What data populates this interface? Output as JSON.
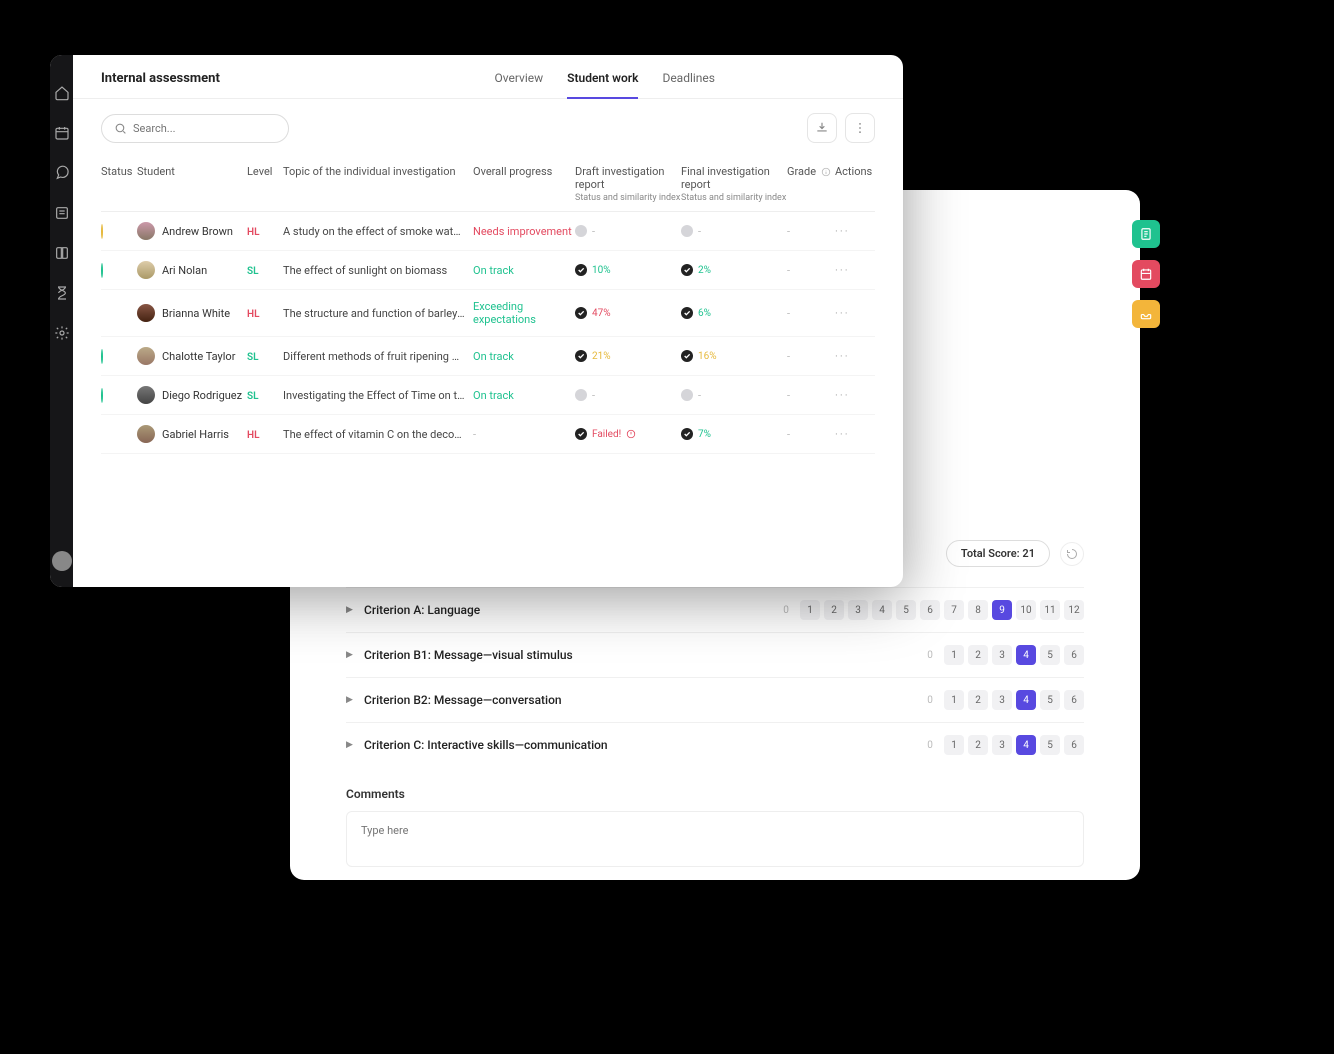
{
  "panel1": {
    "title": "Internal assessment",
    "tabs": [
      {
        "label": "Overview",
        "active": false
      },
      {
        "label": "Student work",
        "active": true
      },
      {
        "label": "Deadlines",
        "active": false
      }
    ],
    "search_placeholder": "Search...",
    "columns": {
      "status": "Status",
      "student": "Student",
      "level": "Level",
      "topic": "Topic of the individual investigation",
      "progress": "Overall progress",
      "draft": "Draft investigation report",
      "draft_sub": "Status and similarity index",
      "final": "Final investigation report",
      "final_sub": "Status and similarity index",
      "grade": "Grade",
      "actions": "Actions"
    },
    "rows": [
      {
        "status": "warn",
        "name": "Andrew Brown",
        "level": "HL",
        "topic": "A study on the effect of smoke water on the ger...",
        "progress": "Needs improvement",
        "progress_cls": "prog-needs",
        "draft": {
          "done": false,
          "val": "-"
        },
        "final": {
          "done": false,
          "val": "-"
        },
        "grade": "-"
      },
      {
        "status": "ok",
        "name": "Ari Nolan",
        "level": "SL",
        "topic": "The effect of sunlight on biomass",
        "progress": "On track",
        "progress_cls": "prog-ontrack",
        "draft": {
          "done": true,
          "val": "10%",
          "cls": "pct-teal"
        },
        "final": {
          "done": true,
          "val": "2%",
          "cls": "pct-teal"
        },
        "grade": "-"
      },
      {
        "status": "done",
        "name": "Brianna White",
        "level": "HL",
        "topic": "The structure and function of barley amylases",
        "progress": "Exceeding expectations",
        "progress_cls": "prog-exceed",
        "draft": {
          "done": true,
          "val": "47%",
          "cls": "pct-red"
        },
        "final": {
          "done": true,
          "val": "6%",
          "cls": "pct-teal"
        },
        "grade": "-"
      },
      {
        "status": "ok",
        "name": "Chalotte Taylor",
        "level": "SL",
        "topic": "Different methods of fruit ripening and the meta...",
        "progress": "On track",
        "progress_cls": "prog-ontrack",
        "draft": {
          "done": true,
          "val": "21%",
          "cls": "pct-yellow"
        },
        "final": {
          "done": true,
          "val": "16%",
          "cls": "pct-yellow"
        },
        "grade": "-"
      },
      {
        "status": "ok",
        "name": "Diego Rodriguez",
        "level": "SL",
        "topic": "Investigating the Effect of Time on the Plasmoly...",
        "progress": "On track",
        "progress_cls": "prog-ontrack",
        "draft": {
          "done": false,
          "val": "-"
        },
        "final": {
          "done": false,
          "val": "-"
        },
        "grade": "-"
      },
      {
        "status": "fail",
        "name": "Gabriel Harris",
        "level": "HL",
        "topic": "The effect of vitamin C on the decomposition of...",
        "progress": "-",
        "progress_cls": "dash",
        "draft": {
          "done": true,
          "val": "Failed!",
          "cls": "pct-red",
          "alert": true
        },
        "final": {
          "done": true,
          "val": "7%",
          "cls": "pct-teal"
        },
        "grade": "-"
      }
    ]
  },
  "panel2": {
    "total_label": "Total Score: 21",
    "criteria": [
      {
        "label": "Criterion A: Language",
        "max": 12,
        "selected": 9
      },
      {
        "label": "Criterion B1: Message—visual stimulus",
        "max": 6,
        "selected": 4
      },
      {
        "label": "Criterion B2: Message—conversation",
        "max": 6,
        "selected": 4
      },
      {
        "label": "Criterion C: Interactive skills—communication",
        "max": 6,
        "selected": 4
      }
    ],
    "comments_label": "Comments",
    "comments_placeholder": "Type here"
  }
}
